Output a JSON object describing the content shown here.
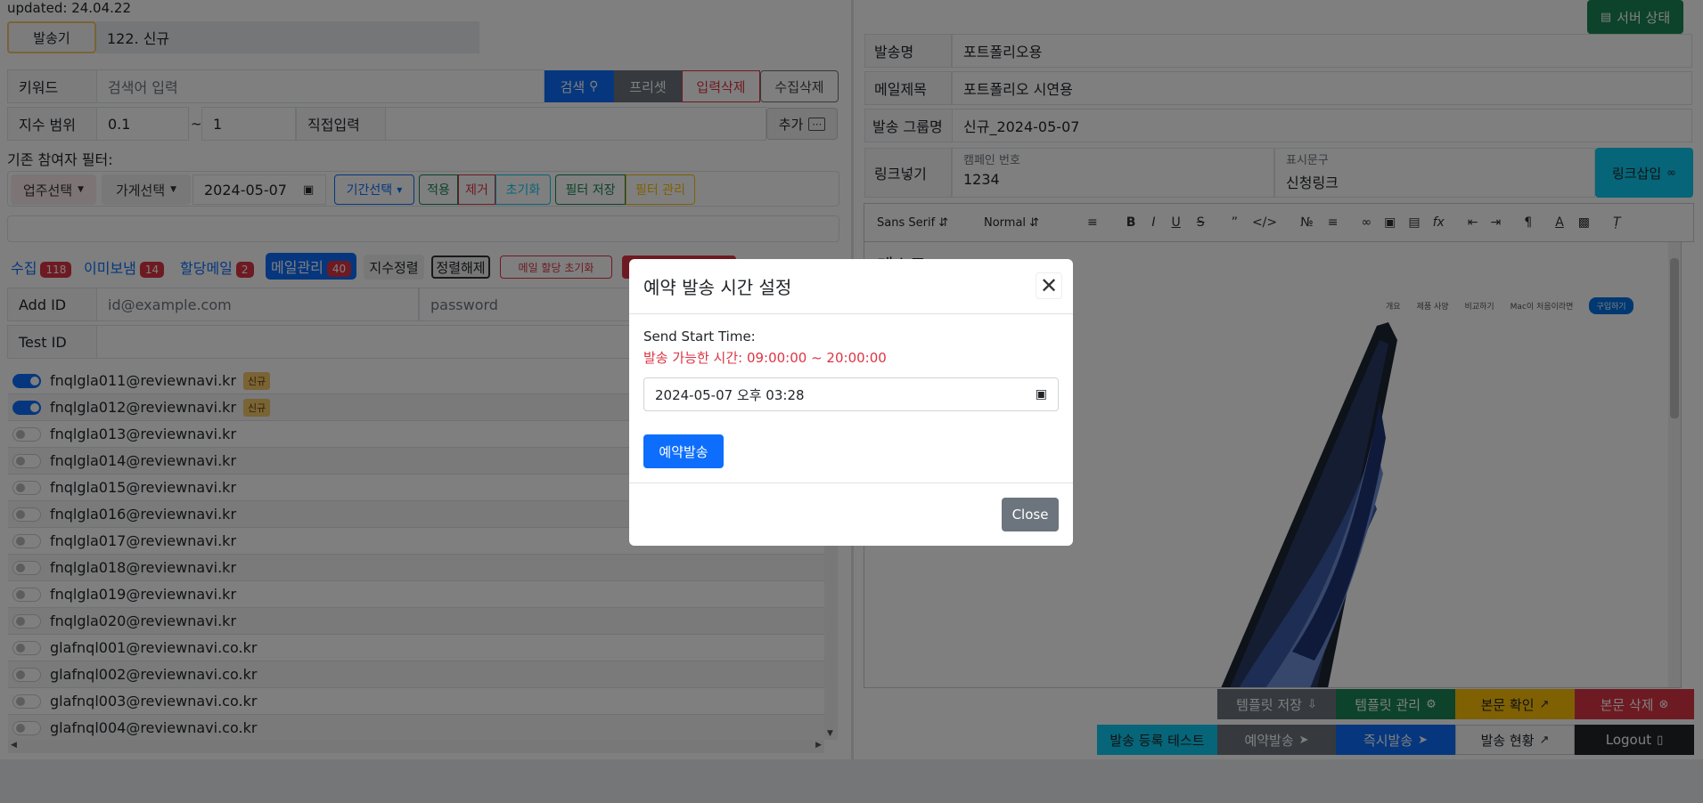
{
  "updated": "updated: 24.04.22",
  "sender": {
    "btn": "발송기",
    "value": "122. 신규"
  },
  "keyword": {
    "label": "키워드",
    "placeholder": "검색어 입력",
    "search": "검색",
    "preset": "프리셋",
    "clear_input": "입력삭제",
    "clear_collect": "수집삭제"
  },
  "range": {
    "label": "지수 범위",
    "from": "0.1",
    "sep": "~",
    "to": "1",
    "direct": "직접입력",
    "add": "추가"
  },
  "filter": {
    "title": "기존 참여자 필터:",
    "biz": "업주선택",
    "store": "가게선택",
    "date": "2024-05-07",
    "period": "기간선택",
    "apply": "적용",
    "remove": "제거",
    "reset": "초기화",
    "save": "필터 저장",
    "manage": "필터 관리"
  },
  "tabs": [
    {
      "label": "수집",
      "count": "118"
    },
    {
      "label": "이미보냄",
      "count": "14"
    },
    {
      "label": "할당메일",
      "count": "2"
    },
    {
      "label": "메일관리",
      "count": "40"
    }
  ],
  "sort": "지수정렬",
  "unsort": "정렬해제",
  "mail_reset": "메일 할당 초기화",
  "add_id": {
    "label": "Add ID",
    "id_ph": "id@example.com",
    "pw_ph": "password"
  },
  "test_id": {
    "label": "Test ID"
  },
  "accounts": [
    {
      "email": "fnqlgla011@reviewnavi.kr",
      "on": true,
      "badge": "신규"
    },
    {
      "email": "fnqlgla012@reviewnavi.kr",
      "on": true,
      "badge": "신규"
    },
    {
      "email": "fnqlgla013@reviewnavi.kr",
      "on": false,
      "badge": ""
    },
    {
      "email": "fnqlgla014@reviewnavi.kr",
      "on": false,
      "badge": ""
    },
    {
      "email": "fnqlgla015@reviewnavi.kr",
      "on": false,
      "badge": ""
    },
    {
      "email": "fnqlgla016@reviewnavi.kr",
      "on": false,
      "badge": ""
    },
    {
      "email": "fnqlgla017@reviewnavi.kr",
      "on": false,
      "badge": ""
    },
    {
      "email": "fnqlgla018@reviewnavi.kr",
      "on": false,
      "badge": ""
    },
    {
      "email": "fnqlgla019@reviewnavi.kr",
      "on": false,
      "badge": ""
    },
    {
      "email": "fnqlgla020@reviewnavi.kr",
      "on": false,
      "badge": ""
    },
    {
      "email": "glafnql001@reviewnavi.co.kr",
      "on": false,
      "badge": ""
    },
    {
      "email": "glafnql002@reviewnavi.co.kr",
      "on": false,
      "badge": ""
    },
    {
      "email": "glafnql003@reviewnavi.co.kr",
      "on": false,
      "badge": ""
    },
    {
      "email": "glafnql004@reviewnavi.co.kr",
      "on": false,
      "badge": ""
    }
  ],
  "right": {
    "server_status": "서버 상태",
    "send_name_label": "발송명",
    "send_name": "포트폴리오용",
    "subject_label": "메일제목",
    "subject": "포트폴리오 시연용",
    "group_label": "발송 그룹명",
    "group": "신규_2024-05-07",
    "link_label": "링크넣기",
    "campaign_label": "캠페인 번호",
    "campaign": "1234",
    "display_label": "표시문구",
    "display": "신청링크",
    "insert_link": "링크삽입",
    "font": "Sans Serif",
    "size": "Normal",
    "editor_text": "테스트",
    "nav_items": [
      "개요",
      "제품 사양",
      "비교하기",
      "Mac이 처음이라면",
      "구입하기"
    ]
  },
  "bottom": {
    "tpl_save": "템플릿 저장",
    "tpl_manage": "템플릿 관리",
    "body_check": "본문 확인",
    "body_delete": "본문 삭제",
    "reg_test": "발송 등록 테스트",
    "schedule": "예약발송",
    "instant": "즉시발송",
    "status": "발송 현황",
    "logout": "Logout"
  },
  "modal": {
    "title": "예약 발송 시간 설정",
    "start_label": "Send Start Time:",
    "allowed": "발송 가능한 시간: 09:00:00 ~ 20:00:00",
    "datetime": "2024-05-07 오후 03:28",
    "submit": "예약발송",
    "close": "Close"
  },
  "colors": {
    "primary": "#0d6efd",
    "danger": "#dc3545",
    "success": "#198754",
    "warning": "#ffc107",
    "info": "#0dcaf0",
    "dark": "#212529",
    "secondary": "#6c757d"
  }
}
